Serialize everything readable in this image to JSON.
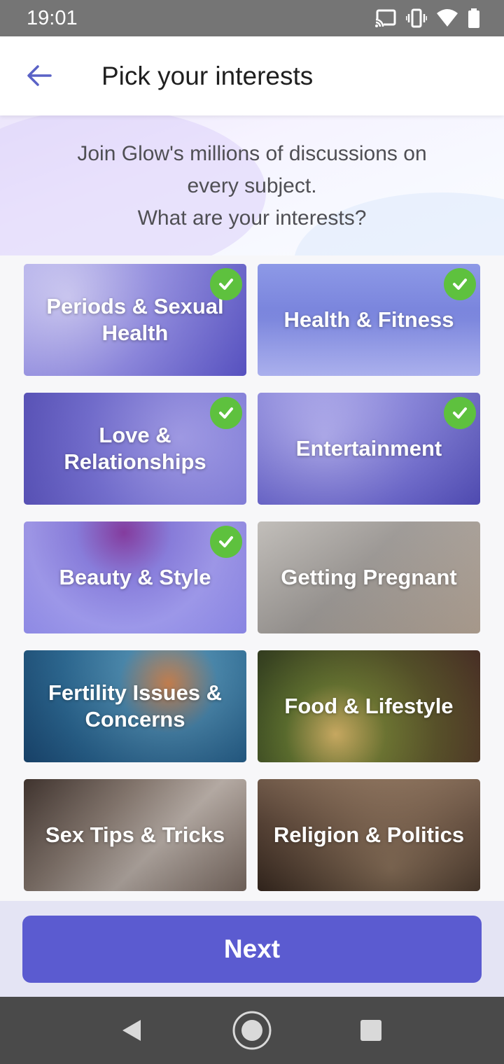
{
  "status_bar": {
    "time": "19:01",
    "icons": [
      "cast-icon",
      "vibrate-icon",
      "wifi-icon",
      "battery-icon"
    ]
  },
  "app_bar": {
    "back_icon": "arrow-left-icon",
    "title": "Pick your interests"
  },
  "intro": {
    "line1": "Join Glow's millions of discussions on",
    "line2": "every subject.",
    "line3": "What are your interests?"
  },
  "interests": [
    {
      "label": "Periods & Sexual Health",
      "selected": true
    },
    {
      "label": "Health & Fitness",
      "selected": true
    },
    {
      "label": "Love & Relationships",
      "selected": true
    },
    {
      "label": "Entertainment",
      "selected": true
    },
    {
      "label": "Beauty & Style",
      "selected": true
    },
    {
      "label": "Getting Pregnant",
      "selected": false
    },
    {
      "label": "Fertility Issues & Concerns",
      "selected": false
    },
    {
      "label": "Food & Lifestyle",
      "selected": false
    },
    {
      "label": "Sex Tips & Tricks",
      "selected": false
    },
    {
      "label": "Religion & Politics",
      "selected": false
    }
  ],
  "footer": {
    "next_label": "Next"
  },
  "nav_bar": {
    "icons": [
      "back-triangle-icon",
      "home-circle-icon",
      "recents-square-icon"
    ]
  },
  "colors": {
    "accent": "#5b5bd0",
    "check": "#5ec13e",
    "selected_overlay": "#7b79d9"
  }
}
